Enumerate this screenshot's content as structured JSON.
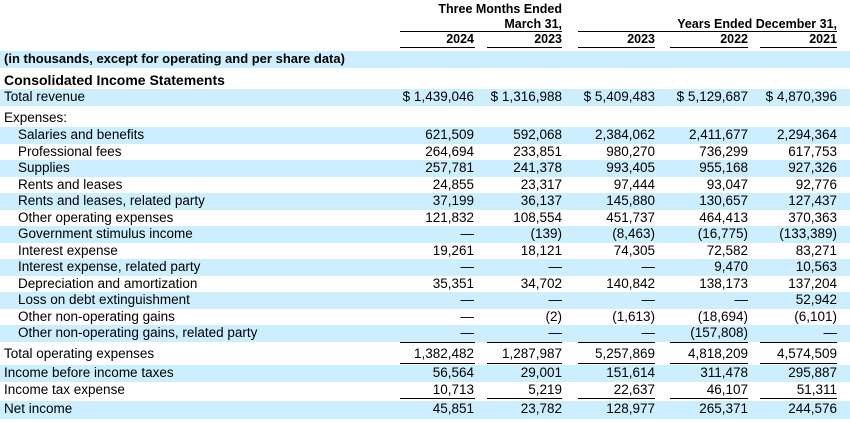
{
  "header": {
    "group1_line1": "Three Months Ended",
    "group1_line2": "March 31,",
    "group2_line1": "Years Ended December 31,",
    "years": [
      "2024",
      "2023",
      "2023",
      "2022",
      "2021"
    ]
  },
  "note": "(in thousands, except for operating and per share data)",
  "section_title": "Consolidated Income Statements",
  "rows": [
    {
      "label": "Total revenue",
      "values": [
        "$ 1,439,046",
        "$ 1,316,988",
        "$ 5,409,483",
        "$ 5,129,687",
        "$ 4,870,396"
      ]
    },
    {
      "label": "Expenses:",
      "values": [
        "",
        "",
        "",
        "",
        ""
      ]
    },
    {
      "label": "Salaries and benefits",
      "values": [
        "621,509",
        "592,068",
        "2,384,062",
        "2,411,677",
        "2,294,364"
      ]
    },
    {
      "label": "Professional fees",
      "values": [
        "264,694",
        "233,851",
        "980,270",
        "736,299",
        "617,753"
      ]
    },
    {
      "label": "Supplies",
      "values": [
        "257,781",
        "241,378",
        "993,405",
        "955,168",
        "927,326"
      ]
    },
    {
      "label": "Rents and leases",
      "values": [
        "24,855",
        "23,317",
        "97,444",
        "93,047",
        "92,776"
      ]
    },
    {
      "label": "Rents and leases, related party",
      "values": [
        "37,199",
        "36,137",
        "145,880",
        "130,657",
        "127,437"
      ]
    },
    {
      "label": "Other operating expenses",
      "values": [
        "121,832",
        "108,554",
        "451,737",
        "464,413",
        "370,363"
      ]
    },
    {
      "label": "Government stimulus income",
      "values": [
        "—",
        "(139)",
        "(8,463)",
        "(16,775)",
        "(133,389)"
      ]
    },
    {
      "label": "Interest expense",
      "values": [
        "19,261",
        "18,121",
        "74,305",
        "72,582",
        "83,271"
      ]
    },
    {
      "label": "Interest expense, related party",
      "values": [
        "—",
        "—",
        "—",
        "9,470",
        "10,563"
      ]
    },
    {
      "label": "Depreciation and amortization",
      "values": [
        "35,351",
        "34,702",
        "140,842",
        "138,173",
        "137,204"
      ]
    },
    {
      "label": "Loss on debt extinguishment",
      "values": [
        "—",
        "—",
        "—",
        "—",
        "52,942"
      ]
    },
    {
      "label": "Other non-operating gains",
      "values": [
        "—",
        "(2)",
        "(1,613)",
        "(18,694)",
        "(6,101)"
      ]
    },
    {
      "label": "Other non-operating gains, related party",
      "values": [
        "—",
        "—",
        "—",
        "(157,808)",
        "—"
      ]
    },
    {
      "label": "Total operating expenses",
      "values": [
        "1,382,482",
        "1,287,987",
        "5,257,869",
        "4,818,209",
        "4,574,509"
      ]
    },
    {
      "label": "Income before income taxes",
      "values": [
        "56,564",
        "29,001",
        "151,614",
        "311,478",
        "295,887"
      ]
    },
    {
      "label": "Income tax expense",
      "values": [
        "10,713",
        "5,219",
        "22,637",
        "46,107",
        "51,311"
      ]
    },
    {
      "label": "Net income",
      "values": [
        "45,851",
        "23,782",
        "128,977",
        "265,371",
        "244,576"
      ]
    }
  ],
  "colors": {
    "shade": "#cceeff",
    "text": "#000000"
  }
}
